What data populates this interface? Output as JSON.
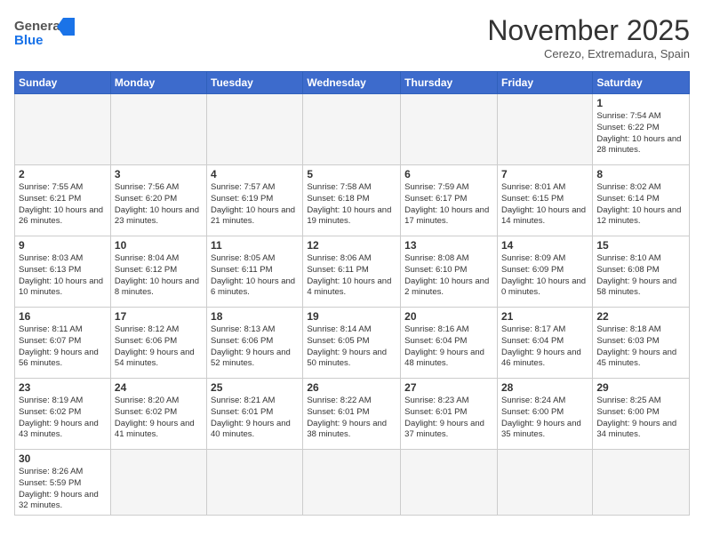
{
  "header": {
    "logo_general": "General",
    "logo_blue": "Blue",
    "month_title": "November 2025",
    "location": "Cerezo, Extremadura, Spain"
  },
  "weekdays": [
    "Sunday",
    "Monday",
    "Tuesday",
    "Wednesday",
    "Thursday",
    "Friday",
    "Saturday"
  ],
  "weeks": [
    [
      {
        "day": "",
        "info": ""
      },
      {
        "day": "",
        "info": ""
      },
      {
        "day": "",
        "info": ""
      },
      {
        "day": "",
        "info": ""
      },
      {
        "day": "",
        "info": ""
      },
      {
        "day": "",
        "info": ""
      },
      {
        "day": "1",
        "info": "Sunrise: 7:54 AM\nSunset: 6:22 PM\nDaylight: 10 hours and 28 minutes."
      }
    ],
    [
      {
        "day": "2",
        "info": "Sunrise: 7:55 AM\nSunset: 6:21 PM\nDaylight: 10 hours and 26 minutes."
      },
      {
        "day": "3",
        "info": "Sunrise: 7:56 AM\nSunset: 6:20 PM\nDaylight: 10 hours and 23 minutes."
      },
      {
        "day": "4",
        "info": "Sunrise: 7:57 AM\nSunset: 6:19 PM\nDaylight: 10 hours and 21 minutes."
      },
      {
        "day": "5",
        "info": "Sunrise: 7:58 AM\nSunset: 6:18 PM\nDaylight: 10 hours and 19 minutes."
      },
      {
        "day": "6",
        "info": "Sunrise: 7:59 AM\nSunset: 6:17 PM\nDaylight: 10 hours and 17 minutes."
      },
      {
        "day": "7",
        "info": "Sunrise: 8:01 AM\nSunset: 6:15 PM\nDaylight: 10 hours and 14 minutes."
      },
      {
        "day": "8",
        "info": "Sunrise: 8:02 AM\nSunset: 6:14 PM\nDaylight: 10 hours and 12 minutes."
      }
    ],
    [
      {
        "day": "9",
        "info": "Sunrise: 8:03 AM\nSunset: 6:13 PM\nDaylight: 10 hours and 10 minutes."
      },
      {
        "day": "10",
        "info": "Sunrise: 8:04 AM\nSunset: 6:12 PM\nDaylight: 10 hours and 8 minutes."
      },
      {
        "day": "11",
        "info": "Sunrise: 8:05 AM\nSunset: 6:11 PM\nDaylight: 10 hours and 6 minutes."
      },
      {
        "day": "12",
        "info": "Sunrise: 8:06 AM\nSunset: 6:11 PM\nDaylight: 10 hours and 4 minutes."
      },
      {
        "day": "13",
        "info": "Sunrise: 8:08 AM\nSunset: 6:10 PM\nDaylight: 10 hours and 2 minutes."
      },
      {
        "day": "14",
        "info": "Sunrise: 8:09 AM\nSunset: 6:09 PM\nDaylight: 10 hours and 0 minutes."
      },
      {
        "day": "15",
        "info": "Sunrise: 8:10 AM\nSunset: 6:08 PM\nDaylight: 9 hours and 58 minutes."
      }
    ],
    [
      {
        "day": "16",
        "info": "Sunrise: 8:11 AM\nSunset: 6:07 PM\nDaylight: 9 hours and 56 minutes."
      },
      {
        "day": "17",
        "info": "Sunrise: 8:12 AM\nSunset: 6:06 PM\nDaylight: 9 hours and 54 minutes."
      },
      {
        "day": "18",
        "info": "Sunrise: 8:13 AM\nSunset: 6:06 PM\nDaylight: 9 hours and 52 minutes."
      },
      {
        "day": "19",
        "info": "Sunrise: 8:14 AM\nSunset: 6:05 PM\nDaylight: 9 hours and 50 minutes."
      },
      {
        "day": "20",
        "info": "Sunrise: 8:16 AM\nSunset: 6:04 PM\nDaylight: 9 hours and 48 minutes."
      },
      {
        "day": "21",
        "info": "Sunrise: 8:17 AM\nSunset: 6:04 PM\nDaylight: 9 hours and 46 minutes."
      },
      {
        "day": "22",
        "info": "Sunrise: 8:18 AM\nSunset: 6:03 PM\nDaylight: 9 hours and 45 minutes."
      }
    ],
    [
      {
        "day": "23",
        "info": "Sunrise: 8:19 AM\nSunset: 6:02 PM\nDaylight: 9 hours and 43 minutes."
      },
      {
        "day": "24",
        "info": "Sunrise: 8:20 AM\nSunset: 6:02 PM\nDaylight: 9 hours and 41 minutes."
      },
      {
        "day": "25",
        "info": "Sunrise: 8:21 AM\nSunset: 6:01 PM\nDaylight: 9 hours and 40 minutes."
      },
      {
        "day": "26",
        "info": "Sunrise: 8:22 AM\nSunset: 6:01 PM\nDaylight: 9 hours and 38 minutes."
      },
      {
        "day": "27",
        "info": "Sunrise: 8:23 AM\nSunset: 6:01 PM\nDaylight: 9 hours and 37 minutes."
      },
      {
        "day": "28",
        "info": "Sunrise: 8:24 AM\nSunset: 6:00 PM\nDaylight: 9 hours and 35 minutes."
      },
      {
        "day": "29",
        "info": "Sunrise: 8:25 AM\nSunset: 6:00 PM\nDaylight: 9 hours and 34 minutes."
      }
    ],
    [
      {
        "day": "30",
        "info": "Sunrise: 8:26 AM\nSunset: 5:59 PM\nDaylight: 9 hours and 32 minutes."
      },
      {
        "day": "",
        "info": ""
      },
      {
        "day": "",
        "info": ""
      },
      {
        "day": "",
        "info": ""
      },
      {
        "day": "",
        "info": ""
      },
      {
        "day": "",
        "info": ""
      },
      {
        "day": "",
        "info": ""
      }
    ]
  ]
}
